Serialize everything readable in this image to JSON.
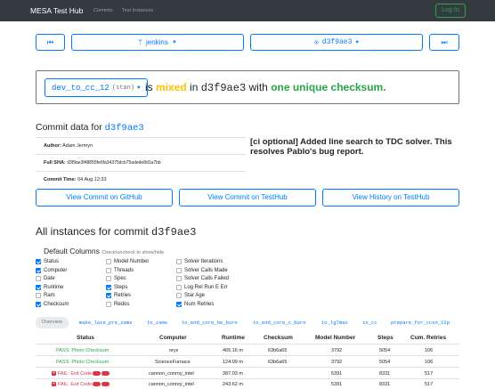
{
  "nav": {
    "brand": "MESA Test Hub",
    "links": [
      "Commits",
      "Test Instances"
    ],
    "login": "Log In"
  },
  "selectors": {
    "branch": "jenkins",
    "commit": "d3f9ae3"
  },
  "summary": {
    "test": "dev_to_cc_12",
    "test_suffix": "(stan)",
    "is": "is",
    "status": "mixed",
    "in": "in",
    "sha": "d3f9ae3",
    "with": "with",
    "checksum_text": "one unique checksum."
  },
  "commit": {
    "heading_prefix": "Commit data for",
    "sha": "d3f9ae3",
    "author_label": "Author:",
    "author": "Adam Jermyn",
    "fullsha_label": "Full SHA:",
    "fullsha": "d3f9ae3f48855fe6fa34375dcb75adede8d1a7bb",
    "date_label": "Commit Time:",
    "date": "04 Aug 12:33",
    "message": "[ci optional] Added line search to TDC solver. This resolves Pablo's bug report."
  },
  "buttons": {
    "github": "View Commit on GitHub",
    "testhub": "View Commit on TestHub",
    "history": "View History on TestHub"
  },
  "instances": {
    "heading_prefix": "All instances for commit",
    "sha": "d3f9ae3"
  },
  "columns": {
    "heading": "Default Columns",
    "hint": "Check/uncheck to show/hide",
    "items": [
      {
        "label": "Status",
        "checked": true
      },
      {
        "label": "Computer",
        "checked": true
      },
      {
        "label": "Date",
        "checked": false
      },
      {
        "label": "Runtime",
        "checked": true
      },
      {
        "label": "Ram",
        "checked": false
      },
      {
        "label": "Checksum",
        "checked": true
      },
      {
        "label": "Model Number",
        "checked": false
      },
      {
        "label": "Threads",
        "checked": false
      },
      {
        "label": "Spec",
        "checked": false
      },
      {
        "label": "Steps",
        "checked": true
      },
      {
        "label": "Retries",
        "checked": true
      },
      {
        "label": "Redos",
        "checked": false
      },
      {
        "label": "Solver Iterations",
        "checked": false
      },
      {
        "label": "Solver Calls Made",
        "checked": false
      },
      {
        "label": "Solver Calls Failed",
        "checked": false
      },
      {
        "label": "Log Rel Run E Err",
        "checked": false
      },
      {
        "label": "Star Age",
        "checked": false
      },
      {
        "label": "Num Retries",
        "checked": true
      }
    ]
  },
  "tabs": [
    "Overview",
    "make_late_pre_zams",
    "to_zams",
    "to_end_core_he_burn",
    "to_end_core_c_burn",
    "to_lgTmax",
    "to_cc",
    "prepare_for_ccsn_IIp"
  ],
  "table": {
    "headers": [
      "Status",
      "Computer",
      "Runtime",
      "Checksum",
      "Model Number",
      "Steps",
      "Cum. Retries"
    ],
    "rows": [
      {
        "status": "PASS: Photo Checksum",
        "type": "pass",
        "computer": "oryx",
        "runtime": "465.16 m",
        "checksum": "63b6a65",
        "model": "3792",
        "steps": "5054",
        "retries": "106"
      },
      {
        "status": "PASS: Photo Checksum",
        "type": "pass",
        "computer": "ScienceFurnace",
        "runtime": "124.09 m",
        "checksum": "63b6a65",
        "model": "3792",
        "steps": "5054",
        "retries": "106"
      },
      {
        "status": "FAIL: Exit Code",
        "type": "fail",
        "computer": "cannon_conroy_intel",
        "runtime": "387.03 m",
        "checksum": "",
        "model": "5391",
        "steps": "8331",
        "retries": "517"
      },
      {
        "status": "FAIL: Exit Code",
        "type": "fail",
        "computer": "cannon_conroy_intel",
        "runtime": "243.62 m",
        "checksum": "",
        "model": "5391",
        "steps": "8331",
        "retries": "517"
      }
    ]
  }
}
